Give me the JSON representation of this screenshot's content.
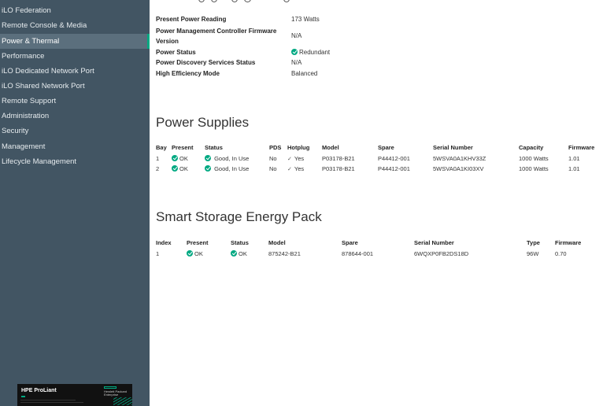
{
  "sidebar": {
    "items": [
      {
        "label": "iLO Federation"
      },
      {
        "label": "Remote Console & Media"
      },
      {
        "label": "Power & Thermal",
        "active": true
      },
      {
        "label": "Performance"
      },
      {
        "label": "iLO Dedicated Network Port"
      },
      {
        "label": "iLO Shared Network Port"
      },
      {
        "label": "Remote Support"
      },
      {
        "label": "Administration"
      },
      {
        "label": "Security"
      },
      {
        "label": "Management"
      },
      {
        "label": "Lifecycle Management"
      }
    ],
    "brand": {
      "title": "HPE ProLiant",
      "logo_text": "Hewlett Packard Enterprise"
    }
  },
  "summary": {
    "present_power_reading": {
      "label": "Present Power Reading",
      "value": "173 Watts"
    },
    "pmc_firmware": {
      "label_line1": "Power Management Controller Firmware",
      "label_line2": "Version",
      "value": "N/A"
    },
    "power_status": {
      "label": "Power Status",
      "value": "Redundant"
    },
    "discovery": {
      "label": "Power Discovery Services Status",
      "value": "N/A"
    },
    "efficiency": {
      "label": "High Efficiency Mode",
      "value": "Balanced"
    }
  },
  "power_supplies": {
    "title": "Power Supplies",
    "columns": [
      "Bay",
      "Present",
      "Status",
      "PDS",
      "Hotplug",
      "Model",
      "Spare",
      "Serial Number",
      "Capacity",
      "Firmware"
    ],
    "rows": [
      {
        "bay": "1",
        "present": "OK",
        "status": "Good, In Use",
        "pds": "No",
        "hotplug": "Yes",
        "model": "P03178-B21",
        "spare": "P44412-001",
        "serial": "5WSVA0A1KHV33Z",
        "capacity": "1000 Watts",
        "firmware": "1.01"
      },
      {
        "bay": "2",
        "present": "OK",
        "status": "Good, In Use",
        "pds": "No",
        "hotplug": "Yes",
        "model": "P03178-B21",
        "spare": "P44412-001",
        "serial": "5WSVA0A1KI03XV",
        "capacity": "1000 Watts",
        "firmware": "1.01"
      }
    ]
  },
  "energy_pack": {
    "title": "Smart Storage Energy Pack",
    "columns": [
      "Index",
      "Present",
      "Status",
      "Model",
      "Spare",
      "Serial Number",
      "Type",
      "Firmware"
    ],
    "rows": [
      {
        "index": "1",
        "present": "OK",
        "status": "OK",
        "model": "875242-B21",
        "spare": "878644-001",
        "serial": "6WQXP0FB2DS18D",
        "type": "96W",
        "firmware": "0.70"
      }
    ]
  },
  "colors": {
    "sidebar_bg": "#425563",
    "accent_green": "#01a982",
    "active_item_bg": "#5b6f7d"
  }
}
